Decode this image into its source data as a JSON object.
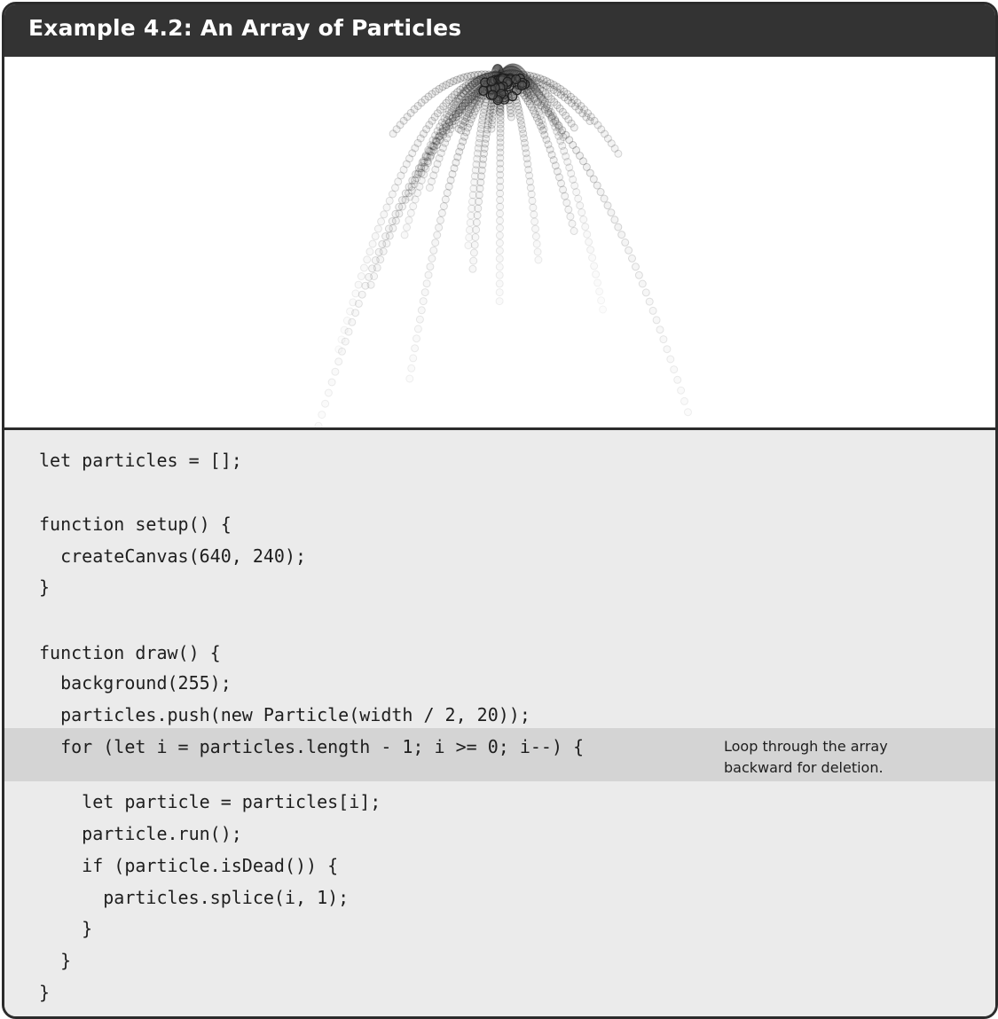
{
  "header": {
    "title": "Example 4.2: An Array of Particles"
  },
  "code": {
    "lines": [
      "let particles = [];",
      "",
      "function setup() {",
      "  createCanvas(640, 240);",
      "}",
      "",
      "function draw() {",
      "  background(255);",
      "  particles.push(new Particle(width / 2, 20));",
      "  for (let i = particles.length - 1; i >= 0; i--) {",
      "    let particle = particles[i];",
      "    particle.run();",
      "    if (particle.isDead()) {",
      "      particles.splice(i, 1);",
      "    }",
      "  }",
      "}"
    ],
    "annotation": "Loop through the array\nbackward for deletion."
  },
  "colors": {
    "header_bg": "#333333",
    "code_bg": "#ebebeb",
    "highlight_bg": "#d4d4d4",
    "particle_stroke": "#1e1e1e"
  }
}
